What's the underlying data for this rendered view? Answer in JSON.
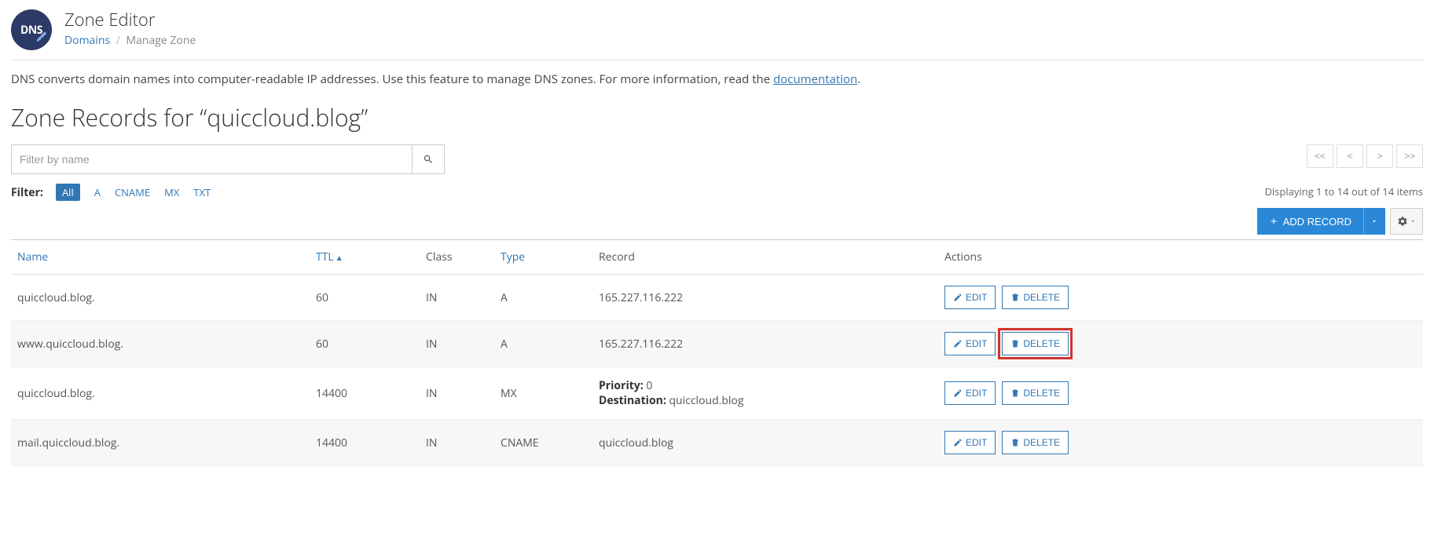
{
  "header": {
    "app_title": "Zone Editor",
    "badge_text": "DNS",
    "breadcrumb": {
      "link": "Domains",
      "current": "Manage Zone"
    }
  },
  "description": {
    "text_before": "DNS converts domain names into computer-readable IP addresses. Use this feature to manage DNS zones. For more information, read the ",
    "link": "documentation",
    "text_after": "."
  },
  "section_title": "Zone Records for “quiccloud.blog”",
  "search": {
    "placeholder": "Filter by name"
  },
  "pager": {
    "first": "<<",
    "prev": "<",
    "next": ">",
    "last": ">>"
  },
  "filter": {
    "label": "Filter:",
    "options": [
      "All",
      "A",
      "CNAME",
      "MX",
      "TXT"
    ],
    "active": "All"
  },
  "displaying": "Displaying 1 to 14 out of 14 items",
  "buttons": {
    "add_record": "ADD RECORD",
    "edit": "EDIT",
    "delete": "DELETE"
  },
  "columns": {
    "name": "Name",
    "ttl": "TTL",
    "class": "Class",
    "type": "Type",
    "record": "Record",
    "actions": "Actions"
  },
  "mx_labels": {
    "priority": "Priority:",
    "destination": "Destination:"
  },
  "rows": [
    {
      "name": "quiccloud.blog.",
      "ttl": "60",
      "class": "IN",
      "type": "A",
      "record_text": "165.227.116.222",
      "highlight_delete": false
    },
    {
      "name": "www.quiccloud.blog.",
      "ttl": "60",
      "class": "IN",
      "type": "A",
      "record_text": "165.227.116.222",
      "highlight_delete": true
    },
    {
      "name": "quiccloud.blog.",
      "ttl": "14400",
      "class": "IN",
      "type": "MX",
      "mx_priority": "0",
      "mx_destination": "quiccloud.blog",
      "highlight_delete": false
    },
    {
      "name": "mail.quiccloud.blog.",
      "ttl": "14400",
      "class": "IN",
      "type": "CNAME",
      "record_text": "quiccloud.blog",
      "highlight_delete": false
    }
  ]
}
